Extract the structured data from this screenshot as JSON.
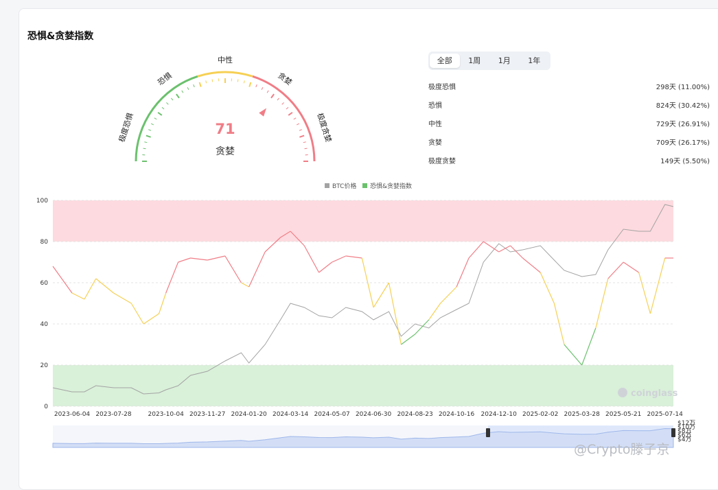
{
  "title": "恐惧&贪婪指数",
  "gauge": {
    "value": 71,
    "status": "贪婪",
    "labels": [
      "极度恐惧",
      "恐惧",
      "中性",
      "贪婪",
      "极度贪婪"
    ]
  },
  "tabs": [
    "全部",
    "1周",
    "1月",
    "1年"
  ],
  "active_tab": "全部",
  "stats": [
    {
      "label": "极度恐惧",
      "value": "298天 (11.00%)"
    },
    {
      "label": "恐惧",
      "value": "824天 (30.42%)"
    },
    {
      "label": "中性",
      "value": "729天 (26.91%)"
    },
    {
      "label": "贪婪",
      "value": "709天 (26.17%)"
    },
    {
      "label": "极度贪婪",
      "value": "149天 (5.50%)"
    }
  ],
  "colors": {
    "greed": "#f07d86",
    "neutral": "#f6d054",
    "fear": "#6bc16d",
    "btc": "#a3a3a3",
    "greed_zone": "#fddadf",
    "fear_zone": "#d9f0d9"
  },
  "chart_data": {
    "type": "line",
    "legend": [
      "BTC价格",
      "恐惧&贪婪指数"
    ],
    "x_ticks": [
      "2023-06-04",
      "2023-07-28",
      "2023-10-04",
      "2023-11-27",
      "2024-01-20",
      "2024-03-14",
      "2024-05-07",
      "2024-06-30",
      "2024-08-23",
      "2024-10-16",
      "2024-12-10",
      "2025-02-02",
      "2025-03-28",
      "2025-05-21",
      "2025-07-14"
    ],
    "y_left_ticks": [
      "0",
      "20",
      "40",
      "60",
      "80",
      "100"
    ],
    "y_right_ticks": [
      "$4万",
      "$6万",
      "$8万",
      "$10万",
      "$12万"
    ],
    "y_left_range": [
      0,
      100
    ],
    "y_right_range": [
      2,
      12
    ],
    "zones": [
      {
        "from": 80,
        "to": 100,
        "color": "greed_zone"
      },
      {
        "from": 0,
        "to": 20,
        "color": "fear_zone"
      }
    ],
    "series": [
      {
        "name": "恐惧&贪婪指数",
        "x": [
          "2023-05-10",
          "2023-06-04",
          "2023-06-20",
          "2023-07-05",
          "2023-07-28",
          "2023-08-20",
          "2023-09-05",
          "2023-09-25",
          "2023-10-04",
          "2023-10-20",
          "2023-11-05",
          "2023-11-27",
          "2023-12-20",
          "2024-01-10",
          "2024-01-20",
          "2024-02-10",
          "2024-03-01",
          "2024-03-14",
          "2024-04-01",
          "2024-04-20",
          "2024-05-07",
          "2024-05-25",
          "2024-06-15",
          "2024-06-30",
          "2024-07-20",
          "2024-08-05",
          "2024-08-23",
          "2024-09-10",
          "2024-09-25",
          "2024-10-16",
          "2024-11-01",
          "2024-11-20",
          "2024-12-10",
          "2024-12-25",
          "2025-01-10",
          "2025-02-02",
          "2025-02-20",
          "2025-03-05",
          "2025-03-28",
          "2025-04-15",
          "2025-05-01",
          "2025-05-21",
          "2025-06-10",
          "2025-06-25",
          "2025-07-14",
          "2025-07-25"
        ],
        "y": [
          68,
          55,
          52,
          62,
          55,
          50,
          40,
          45,
          55,
          70,
          72,
          71,
          73,
          60,
          58,
          75,
          82,
          85,
          78,
          65,
          70,
          73,
          72,
          48,
          60,
          30,
          35,
          42,
          50,
          58,
          72,
          80,
          75,
          78,
          72,
          65,
          50,
          30,
          20,
          38,
          62,
          70,
          65,
          45,
          72,
          72
        ]
      },
      {
        "name": "BTC价格",
        "x": [
          "2023-05-10",
          "2023-06-04",
          "2023-06-20",
          "2023-07-05",
          "2023-07-28",
          "2023-08-20",
          "2023-09-05",
          "2023-09-25",
          "2023-10-04",
          "2023-10-20",
          "2023-11-05",
          "2023-11-27",
          "2023-12-20",
          "2024-01-10",
          "2024-01-20",
          "2024-02-10",
          "2024-03-01",
          "2024-03-14",
          "2024-04-01",
          "2024-04-20",
          "2024-05-07",
          "2024-05-25",
          "2024-06-15",
          "2024-06-30",
          "2024-07-20",
          "2024-08-05",
          "2024-08-23",
          "2024-09-10",
          "2024-09-25",
          "2024-10-16",
          "2024-11-01",
          "2024-11-20",
          "2024-12-10",
          "2024-12-25",
          "2025-01-10",
          "2025-02-02",
          "2025-02-20",
          "2025-03-05",
          "2025-03-28",
          "2025-04-15",
          "2025-05-01",
          "2025-05-21",
          "2025-06-10",
          "2025-06-25",
          "2025-07-14",
          "2025-07-25"
        ],
        "y": [
          2.9,
          2.7,
          2.7,
          3.0,
          2.9,
          2.9,
          2.6,
          2.65,
          2.8,
          3.0,
          3.5,
          3.7,
          4.2,
          4.6,
          4.1,
          5.0,
          6.2,
          7.0,
          6.8,
          6.4,
          6.3,
          6.8,
          6.6,
          6.2,
          6.6,
          5.4,
          6.0,
          5.8,
          6.3,
          6.7,
          7.0,
          9.0,
          9.9,
          9.5,
          9.6,
          9.8,
          9.1,
          8.6,
          8.3,
          8.4,
          9.6,
          10.6,
          10.5,
          10.5,
          11.8,
          11.7
        ]
      }
    ]
  },
  "brand": "coinglass",
  "watermark": "@Crypto滕子京"
}
